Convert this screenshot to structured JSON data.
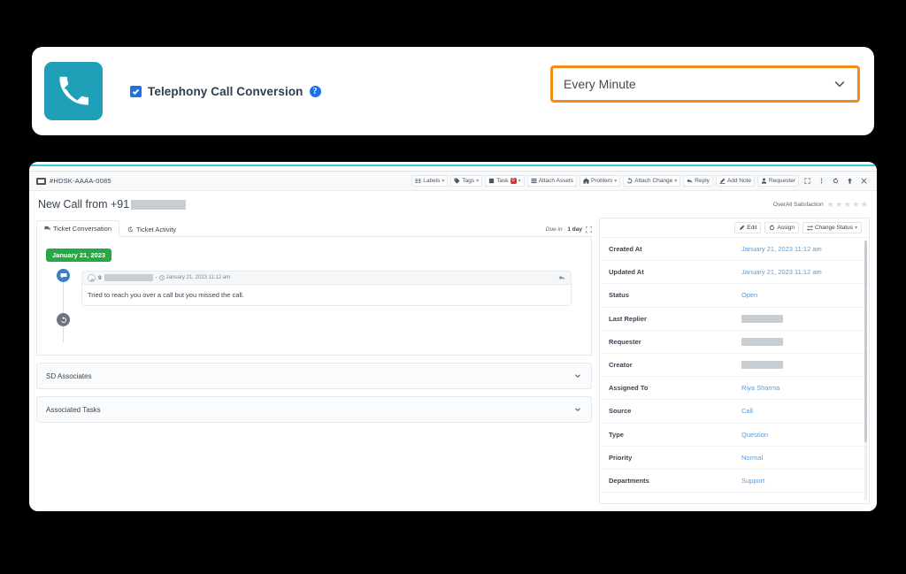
{
  "top_card": {
    "phone_icon": "phone-icon",
    "checkbox_checked": true,
    "feature_label": "Telephony Call Conversion",
    "help_icon": "help-circle-icon",
    "frequency": {
      "value": "Every Minute",
      "caret_icon": "chevron-down-icon",
      "highlight_color": "#f28c1c"
    }
  },
  "app": {
    "ticket_id": "#HDSK-AAAA-0085",
    "ticket_id_icon": "ticket-icon",
    "toolbar": [
      {
        "label": "Labels",
        "icon": "labels-icon",
        "caret": true
      },
      {
        "label": "Tags",
        "icon": "tag-icon",
        "caret": true
      },
      {
        "label": "Task",
        "icon": "task-icon",
        "badge": "0",
        "caret": true
      },
      {
        "label": "Attach Assets",
        "icon": "assets-icon",
        "caret": false
      },
      {
        "label": "Problem",
        "icon": "problem-icon",
        "caret": true
      },
      {
        "label": "Attach Change",
        "icon": "change-icon",
        "caret": true
      },
      {
        "label": "Reply",
        "icon": "reply-icon",
        "caret": false
      },
      {
        "label": "Add Note",
        "icon": "note-icon",
        "caret": false
      },
      {
        "label": "Requester",
        "icon": "user-icon",
        "caret": false
      }
    ],
    "toolbar_icons": [
      "expand-icon",
      "kebab-menu-icon",
      "refresh-icon",
      "arrow-up-icon",
      "close-icon"
    ],
    "title_prefix": "New Call from +91",
    "title_redacted": true,
    "satisfaction": {
      "label": "OverAll Satisfaction",
      "stars_total": 5,
      "stars_filled": 0
    },
    "tabs": [
      {
        "label": "Ticket Conversation",
        "icon": "conversation-icon",
        "active": true
      },
      {
        "label": "Ticket Activity",
        "icon": "activity-icon",
        "active": false
      }
    ],
    "due": {
      "text": "Due in · ",
      "value": "1 day",
      "expand_icon": "expand-icon"
    },
    "conversation": {
      "date_badge": "January 21, 2023",
      "date_badge_color": "#28a745",
      "message": {
        "author": "9",
        "author_redacted": true,
        "separator": "-",
        "clock_icon": "clock-icon",
        "timestamp": "January 21, 2023 11:12 am",
        "reply_icon": "reply-arrow-icon",
        "body": "Tried to reach you over a call but you missed the call."
      },
      "history_icon": "history-icon"
    },
    "accordions": [
      {
        "label": "SD Associates",
        "caret_icon": "chevron-down-icon"
      },
      {
        "label": "Associated Tasks",
        "caret_icon": "chevron-down-icon"
      }
    ],
    "details": {
      "actions": [
        {
          "label": "Edit",
          "icon": "edit-icon",
          "caret": false
        },
        {
          "label": "Assign",
          "icon": "assign-icon",
          "caret": false
        },
        {
          "label": "Change Status",
          "icon": "status-icon",
          "caret": true
        }
      ],
      "rows": [
        {
          "key": "Created At",
          "value": "January 21, 2023 11:12 am",
          "type": "link"
        },
        {
          "key": "Updated At",
          "value": "January 21, 2023 11:12 am",
          "type": "link"
        },
        {
          "key": "Status",
          "value": "Open",
          "type": "link"
        },
        {
          "key": "Last Replier",
          "value": "",
          "type": "redacted"
        },
        {
          "key": "Requester",
          "value": "",
          "type": "redacted"
        },
        {
          "key": "Creator",
          "value": "",
          "type": "redacted"
        },
        {
          "key": "Assigned To",
          "value": "Riya Sharma",
          "type": "link"
        },
        {
          "key": "Source",
          "value": "Call",
          "type": "link"
        },
        {
          "key": "Type",
          "value": "Question",
          "type": "link"
        },
        {
          "key": "Priority",
          "value": "Normal",
          "type": "link"
        },
        {
          "key": "Departments",
          "value": "Support",
          "type": "link"
        }
      ]
    }
  }
}
